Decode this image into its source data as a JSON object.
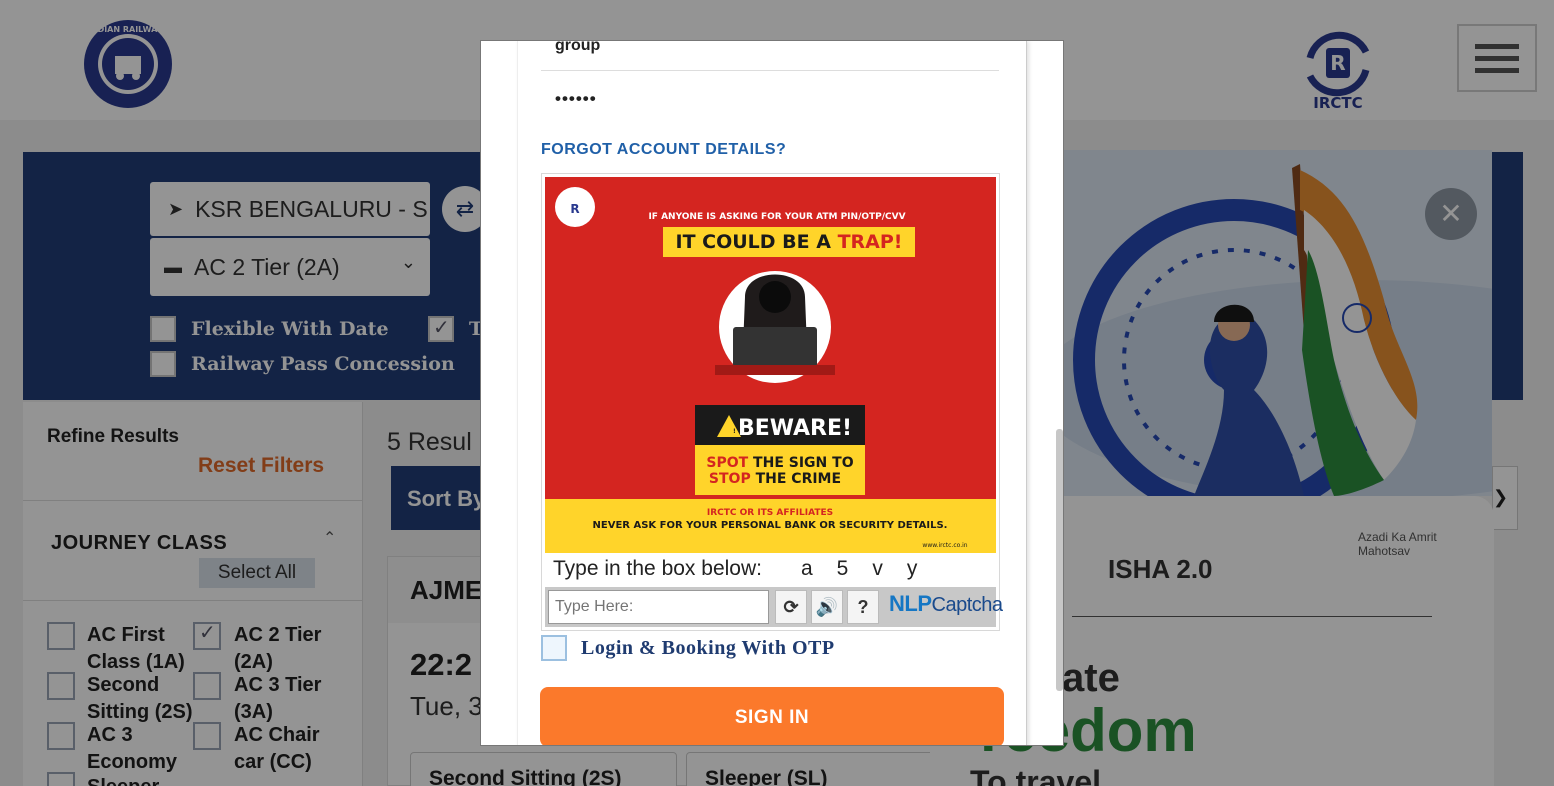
{
  "header": {
    "logo_left_alt": "Indian Railways",
    "logo_left_text": "INDIAN RAILWAYS",
    "logo_right_text": "IRCTC",
    "menu_icon": "hamburger-icon"
  },
  "search": {
    "from_station": "KSR BENGALURU - S",
    "journey_class": "AC 2 Tier (2A)",
    "options": [
      {
        "label": "Flexible With Date",
        "checked": false
      },
      {
        "label": "T",
        "checked": true
      },
      {
        "label": "Railway Pass Concession",
        "checked": false
      }
    ]
  },
  "refine": {
    "title": "Refine Results",
    "reset": "Reset Filters",
    "journey_class_heading": "JOURNEY CLASS",
    "select_all": "Select All",
    "classes": [
      {
        "label": "AC First Class (1A)",
        "checked": false
      },
      {
        "label": "AC 2 Tier (2A)",
        "checked": true
      },
      {
        "label": "Second Sitting (2S)",
        "checked": false
      },
      {
        "label": "AC 3 Tier (3A)",
        "checked": false
      },
      {
        "label": "AC 3 Economy",
        "checked": false
      },
      {
        "label": "AC Chair car (CC)",
        "checked": false
      },
      {
        "label": "Sleeper",
        "checked": false
      }
    ]
  },
  "results": {
    "count_text": "5 Resul",
    "sort_text": "Sort By",
    "train_name": "AJME",
    "depart_time": "22:2",
    "depart_date": "Tue, 3",
    "tabs": [
      "Second Sitting (2S)",
      "Sleeper (SL)"
    ]
  },
  "promo": {
    "close_icon": "close-icon",
    "title_fragment": "ISHA 2.0",
    "azadi_text": "Azadi Ka Amrit Mahotsav",
    "celebrate": "brate",
    "freedom": "reedom",
    "travel": "To travel"
  },
  "modal": {
    "username_value": "group",
    "password_value": "••••••",
    "forgot_link": "FORGOT ACCOUNT DETAILS?",
    "ad": {
      "line1": "IF ANYONE IS ASKING FOR YOUR ATM PIN/OTP/CVV",
      "headline_a": "IT COULD BE A ",
      "headline_b": "TRAP!",
      "beware": "BEWARE!",
      "spot_a": "SPOT",
      "spot_b": " THE SIGN TO",
      "stop_a": "STOP",
      "stop_b": " THE CRIME",
      "footer1": "IRCTC OR ITS AFFILIATES",
      "footer2": "NEVER ASK FOR YOUR PERSONAL BANK OR SECURITY DETAILS.",
      "site": "www.irctc.co.in"
    },
    "captcha_prompt": "Type in the box below:",
    "captcha_code": "a5vy",
    "captcha_placeholder": "Type Here:",
    "captcha_brand_a": "NLP",
    "captcha_brand_b": "Captcha",
    "otp_label": "Login & Booking With OTP",
    "otp_checked": false,
    "signin": "SIGN IN"
  },
  "colors": {
    "navy": "#213d77",
    "orange": "#fb792b",
    "link_blue": "#2060a8",
    "ad_red": "#d42520",
    "ad_yellow": "#ffd42a"
  }
}
